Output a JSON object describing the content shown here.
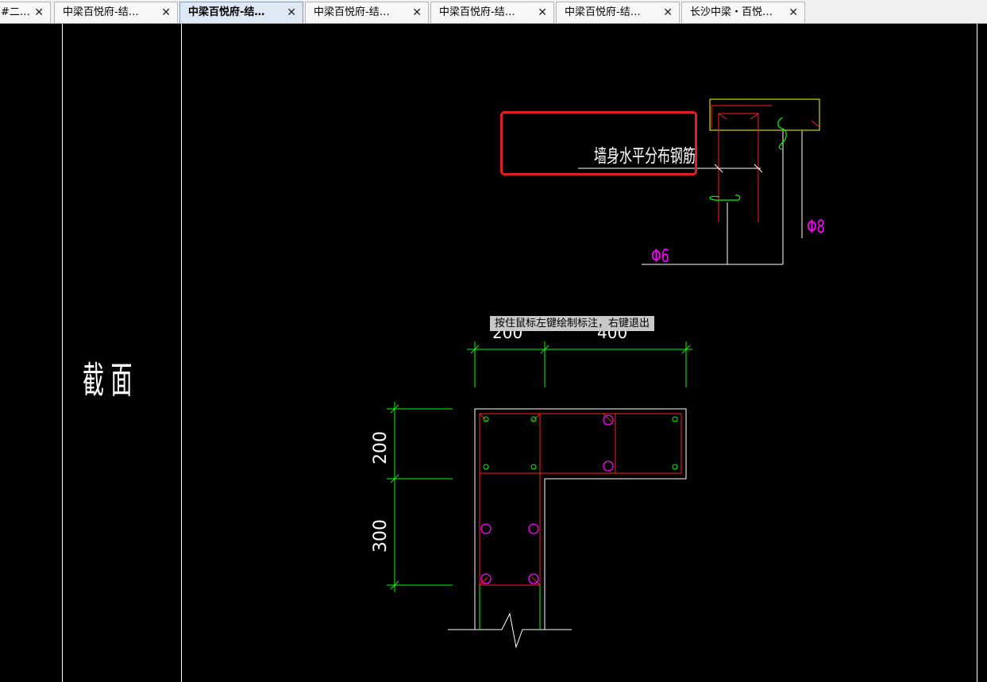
{
  "tabs": [
    {
      "label": "#二…",
      "active": false
    },
    {
      "label": "中梁百悦府-结…",
      "active": false
    },
    {
      "label": "中梁百悦府-结…",
      "active": true
    },
    {
      "label": "中梁百悦府-结…",
      "active": false
    },
    {
      "label": "中梁百悦府-结…",
      "active": false
    },
    {
      "label": "中梁百悦府-结…",
      "active": false
    },
    {
      "label": "长沙中梁・百悦…",
      "active": false
    }
  ],
  "tab_close_glyph": "✕",
  "drawing": {
    "section_title": "截 面",
    "rebar_label": "墙身水平分布钢筋",
    "bar_phi6": "Φ6",
    "bar_phi8": "Φ8",
    "dim_top_left": "200",
    "dim_top_right": "400",
    "dim_left_upper": "200",
    "dim_left_lower": "300"
  },
  "tooltip": "按住鼠标左键绘制标注，右键退出",
  "colors": {
    "background": "#000000",
    "line_white": "#ffffff",
    "dimension": "#00ff00",
    "rebar": "#ff2020",
    "rebar_point": "#ff00ff",
    "yellow": "#ffff00",
    "highlight": "#e0201e"
  }
}
